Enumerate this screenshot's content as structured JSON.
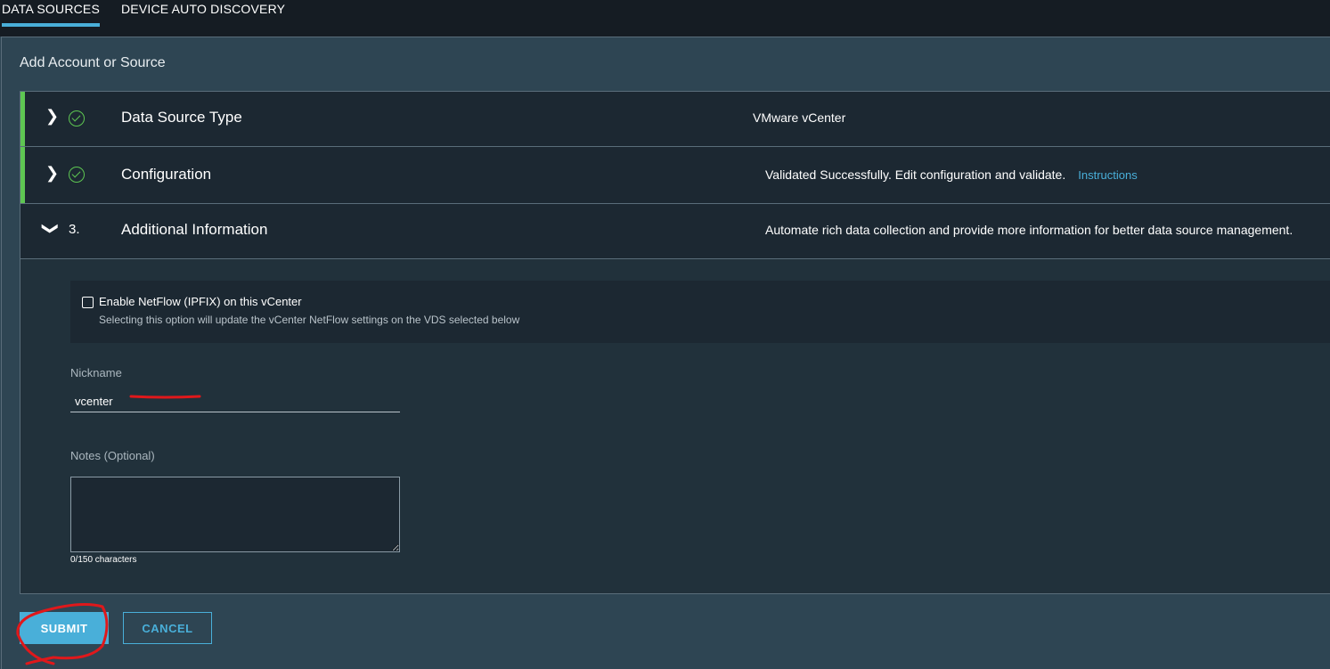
{
  "tabs": [
    {
      "label": "DATA SOURCES",
      "active": true
    },
    {
      "label": "DEVICE AUTO DISCOVERY",
      "active": false
    }
  ],
  "panel": {
    "title": "Add Account or Source"
  },
  "steps": [
    {
      "marker": "check-circle-icon",
      "title": "Data Source Type",
      "summary": "VMware vCenter",
      "expanded": false,
      "status": "complete"
    },
    {
      "marker": "check-circle-icon",
      "title": "Configuration",
      "summary": "Validated Successfully. Edit configuration and validate.",
      "link": "Instructions",
      "expanded": false,
      "status": "complete"
    },
    {
      "marker": "3.",
      "title": "Additional Information",
      "summary": "Automate rich data collection and provide more information for better data source management.",
      "expanded": true
    }
  ],
  "netflow": {
    "label": "Enable NetFlow (IPFIX) on this vCenter",
    "help": "Selecting this option will update the vCenter NetFlow settings on the VDS selected below",
    "checked": false
  },
  "nickname": {
    "label": "Nickname",
    "value": "vcenter"
  },
  "notes": {
    "label": "Notes (Optional)",
    "value": "",
    "counter": "0/150 characters"
  },
  "actions": {
    "submit": "SUBMIT",
    "cancel": "CANCEL"
  },
  "colors": {
    "accent": "#49afd9",
    "success": "#5ec652",
    "annotation": "#e0181b"
  }
}
